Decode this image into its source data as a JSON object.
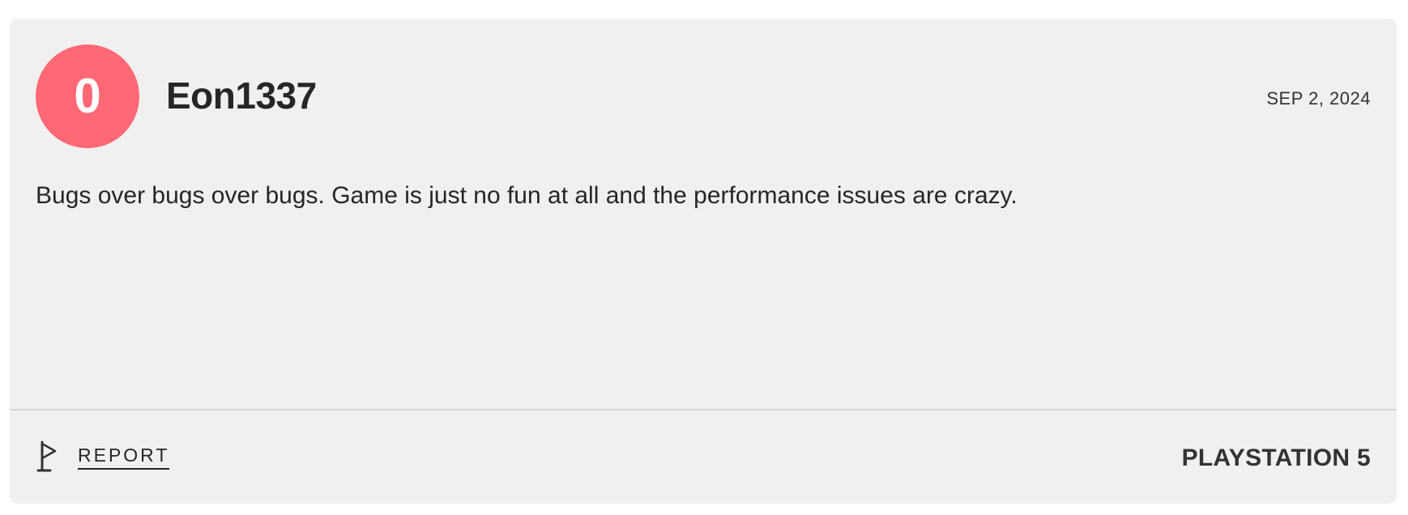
{
  "review": {
    "score": "0",
    "score_color": "#ff6874",
    "username": "Eon1337",
    "date": "SEP 2, 2024",
    "quote": "Bugs over bugs over bugs. Game is just no fun at all and the performance issues are crazy.",
    "report_label": "REPORT",
    "report_icon": "flag-icon",
    "platform": "PLAYSTATION 5"
  }
}
